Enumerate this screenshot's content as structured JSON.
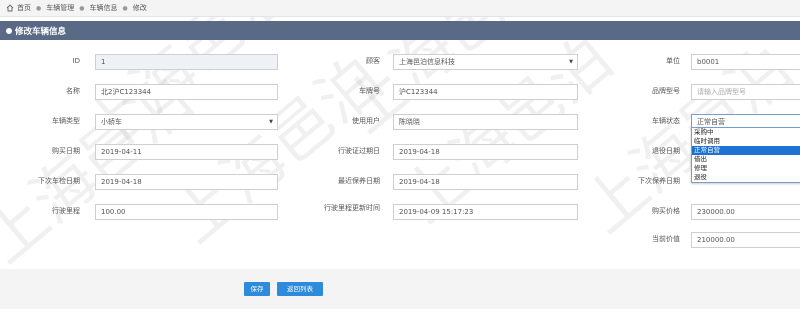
{
  "breadcrumb": {
    "items": [
      "首页",
      "车辆管理",
      "车辆信息",
      "修改"
    ],
    "icon": "home-icon"
  },
  "panel": {
    "title": "修改车辆信息"
  },
  "form": {
    "id": {
      "label": "ID",
      "value": "1"
    },
    "customer": {
      "label": "顾客",
      "value": "上海邑泊信息科技"
    },
    "unit_no": {
      "label": "单位",
      "value": "b0001"
    },
    "name": {
      "label": "名称",
      "value": "北2沪C123344"
    },
    "plate": {
      "label": "车牌号",
      "value": "沪C123344"
    },
    "brand_model": {
      "label": "品牌型号",
      "placeholder": "请输入品牌型号"
    },
    "vehicle_type": {
      "label": "车辆类型",
      "value": "小轿车"
    },
    "user": {
      "label": "使用用户",
      "value": "陈晓晓"
    },
    "vehicle_status": {
      "label": "车辆状态",
      "value": "正常自营"
    },
    "purchase_date": {
      "label": "购买日期",
      "value": "2019-04-11"
    },
    "license_expiry": {
      "label": "行驶证过期日",
      "value": "2019-04-18"
    },
    "retire_date": {
      "label": "退役日期"
    },
    "next_inspection": {
      "label": "下次车检日期",
      "value": "2019-04-18"
    },
    "last_maintenance": {
      "label": "最近保养日期",
      "value": "2019-04-18"
    },
    "next_maintenance": {
      "label": "下次保养日期"
    },
    "mileage": {
      "label": "行驶里程",
      "value": "100.00"
    },
    "mileage_updated": {
      "label": "行驶里程更新时间",
      "value": "2019-04-09 15:17:23"
    },
    "purchase_price": {
      "label": "购买价格",
      "value": "230000.00"
    },
    "current_value": {
      "label": "当前价值",
      "value": "210000.00"
    }
  },
  "status_dropdown": {
    "options": [
      "采购中",
      "临时调用",
      "正常自营",
      "借出",
      "修理",
      "退役"
    ],
    "selected": "正常自营"
  },
  "buttons": {
    "save": "保存",
    "back": "返回列表"
  },
  "watermark": "上海邑泊",
  "colors": {
    "header": "#5a6a86",
    "button": "#2e8bdb",
    "selected": "#1e73d2"
  }
}
